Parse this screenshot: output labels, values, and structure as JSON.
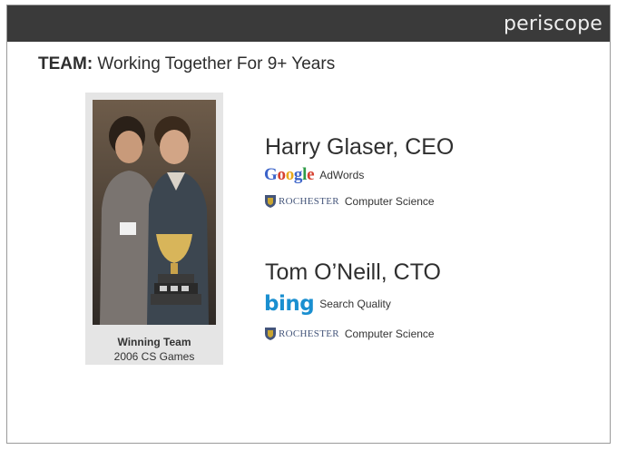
{
  "header": {
    "brand": "periscope"
  },
  "title": {
    "kicker": "TEAM:",
    "text": " Working Together For 9+ Years"
  },
  "photo": {
    "caption_strong": "Winning Team",
    "caption": "2006 CS Games"
  },
  "people": [
    {
      "name": "Harry Glaser, CEO",
      "credentials": [
        {
          "logo": "google-logo",
          "logo_text": "Google",
          "text": "AdWords"
        },
        {
          "logo": "rochester-logo",
          "logo_text": "ROCHESTER",
          "text": "Computer Science"
        }
      ]
    },
    {
      "name": "Tom O’Neill, CTO",
      "credentials": [
        {
          "logo": "bing-logo",
          "logo_text": "bing",
          "text": "Search Quality"
        },
        {
          "logo": "rochester-logo",
          "logo_text": "ROCHESTER",
          "text": "Computer Science"
        }
      ]
    }
  ],
  "colors": {
    "header_bg": "#3a3a3a",
    "google_blue": "#3b63c9",
    "google_red": "#d6402f",
    "google_yellow": "#e9a91c",
    "google_green": "#2f9b48",
    "bing_blue": "#1a8fd0",
    "rochester_blue": "#44557a",
    "rochester_gold": "#c9a531"
  }
}
